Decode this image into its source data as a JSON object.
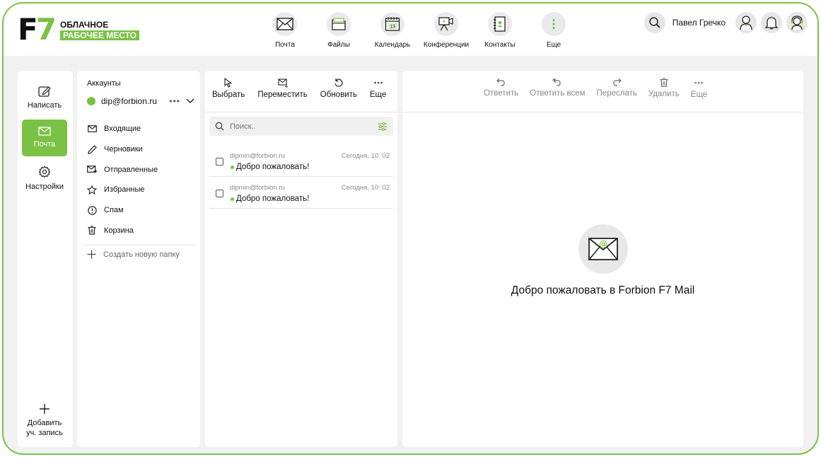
{
  "brand": {
    "mark_f": "F",
    "mark_7": "7",
    "line1": "ОБЛАЧНОЕ",
    "line2": "РАБОЧЕЕ МЕСТО",
    "accent_color": "#7bc244"
  },
  "topnav": [
    {
      "label": "Почта",
      "icon": "mail-icon"
    },
    {
      "label": "Файлы",
      "icon": "files-icon"
    },
    {
      "label": "Календарь",
      "icon": "calendar-icon",
      "badge": "13"
    },
    {
      "label": "Конференции",
      "icon": "video-camera-icon"
    },
    {
      "label": "Контакты",
      "icon": "contacts-book-icon"
    },
    {
      "label": "Еще",
      "icon": "more-vertical-icon"
    }
  ],
  "user": {
    "name": "Павел Гречко"
  },
  "rail": {
    "compose": "Написать",
    "mail": "Почта",
    "settings": "Настройки",
    "add_account": "Добавить уч. запись"
  },
  "folders": {
    "title": "Аккаунты",
    "account_email": "dip@forbion.ru",
    "items": [
      {
        "label": "Входящие",
        "icon": "inbox-icon"
      },
      {
        "label": "Черновики",
        "icon": "pencil-icon"
      },
      {
        "label": "Отправленные",
        "icon": "sent-icon"
      },
      {
        "label": "Избранные",
        "icon": "star-icon"
      },
      {
        "label": "Спам",
        "icon": "spam-icon"
      },
      {
        "label": "Корзина",
        "icon": "trash-icon"
      }
    ],
    "new_folder": "Создать новую папку"
  },
  "list_toolbar": {
    "select": "Выбрать",
    "move": "Переместить",
    "refresh": "Обновить",
    "more": "Еще"
  },
  "search": {
    "placeholder": "Поиск.."
  },
  "messages": [
    {
      "from": "dipmin@forbion.ru",
      "date": "Сегодня, 10: 02",
      "subject": "Добро пожаловать!"
    },
    {
      "from": "dipmin@forbion.ru",
      "date": "Сегодня, 10: 02",
      "subject": "Добро пожаловать!"
    }
  ],
  "reader_toolbar": {
    "reply": "Ответить",
    "reply_all": "Ответить всем",
    "forward": "Переслать",
    "delete": "Удалить",
    "more": "Еще"
  },
  "reader": {
    "welcome": "Добро пожаловать в Forbion F7 Mail"
  }
}
